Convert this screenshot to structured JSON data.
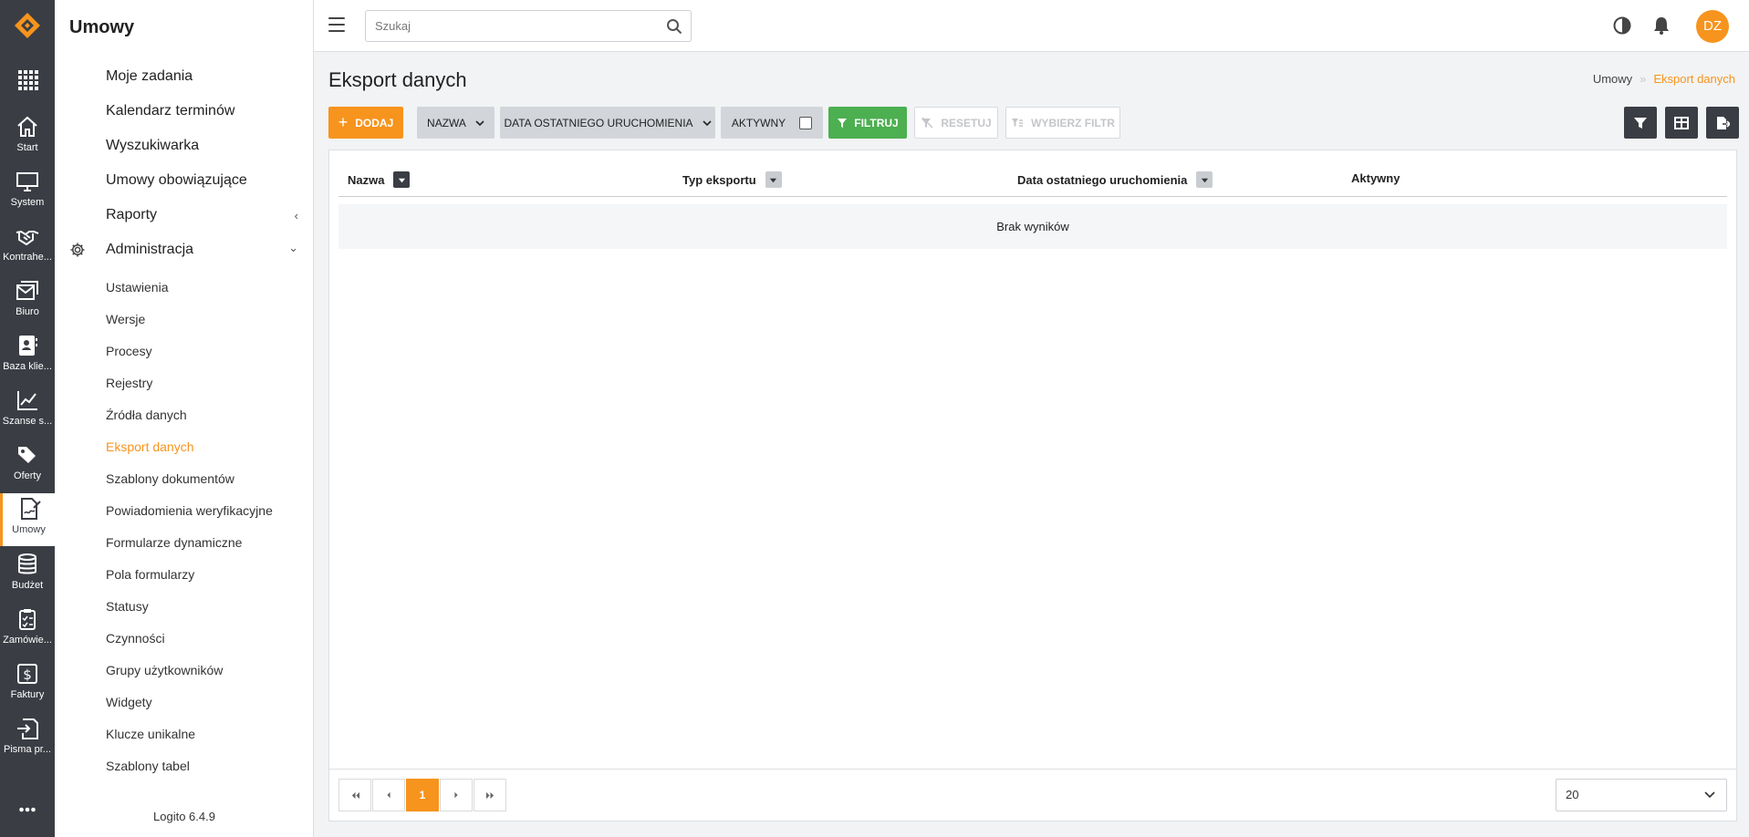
{
  "rail": {
    "items": [
      {
        "label": "Start",
        "icon": "home-icon"
      },
      {
        "label": "System",
        "icon": "monitor-icon"
      },
      {
        "label": "Kontrahe...",
        "icon": "handshake-icon"
      },
      {
        "label": "Biuro",
        "icon": "mail-icon"
      },
      {
        "label": "Baza klie...",
        "icon": "contacts-icon"
      },
      {
        "label": "Szanse s...",
        "icon": "chart-line-icon"
      },
      {
        "label": "Oferty",
        "icon": "tags-icon"
      },
      {
        "label": "Umowy",
        "icon": "contract-icon"
      },
      {
        "label": "Budżet",
        "icon": "database-icon"
      },
      {
        "label": "Zamówie...",
        "icon": "clipboard-icon"
      },
      {
        "label": "Faktury",
        "icon": "dollar-icon"
      },
      {
        "label": "Pisma pr...",
        "icon": "sign-in-icon"
      }
    ]
  },
  "menu": {
    "title": "Umowy",
    "main": [
      {
        "label": "Moje zadania"
      },
      {
        "label": "Kalendarz terminów"
      },
      {
        "label": "Wyszukiwarka"
      },
      {
        "label": "Umowy obowiązujące"
      },
      {
        "label": "Raporty",
        "chevron": "‹"
      },
      {
        "label": "Administracja",
        "chevron": "⌄"
      }
    ],
    "sub": [
      "Ustawienia",
      "Wersje",
      "Procesy",
      "Rejestry",
      "Źródła danych",
      "Eksport danych",
      "Szablony dokumentów",
      "Powiadomienia weryfikacyjne",
      "Formularze dynamiczne",
      "Pola formularzy",
      "Statusy",
      "Czynności",
      "Grupy użytkowników",
      "Widgety",
      "Klucze unikalne",
      "Szablony tabel"
    ],
    "version": "Logito 6.4.9"
  },
  "topbar": {
    "search_placeholder": "Szukaj",
    "avatar_initials": "DZ"
  },
  "page": {
    "title": "Eksport danych",
    "breadcrumb": [
      "Umowy",
      "»",
      "Eksport danych"
    ]
  },
  "toolbar": {
    "add": "Dodaj",
    "f_name": "Nazwa",
    "f_date": "Data ostatniego uruchomienia",
    "f_active": "Aktywny",
    "filter": "Filtruj",
    "reset": "Resetuj",
    "choose": "Wybierz filtr"
  },
  "table": {
    "columns": [
      "Nazwa",
      "Typ eksportu",
      "Data ostatniego uruchomienia",
      "Aktywny"
    ],
    "empty": "Brak wyników"
  },
  "pagination": {
    "current": "1",
    "page_size": "20"
  },
  "colors": {
    "accent": "#f7941d",
    "rail": "#3a3d44",
    "success": "#4caf50"
  }
}
